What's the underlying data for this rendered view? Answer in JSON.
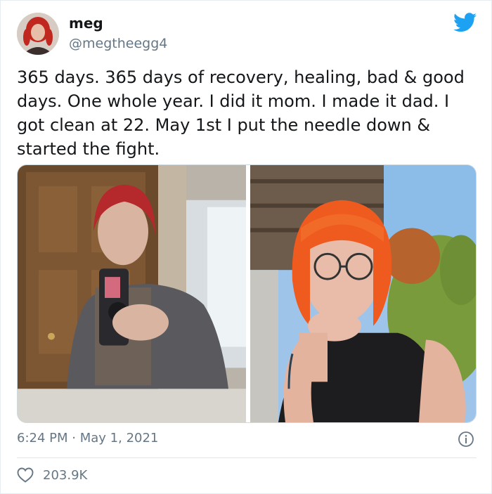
{
  "tweet": {
    "author_name": "meg",
    "author_handle": "@megtheegg4",
    "text": "365 days. 365 days of recovery, healing, bad & good days. One whole year. I did it mom. I made it dad. I got clean at 22. May 1st I put the needle down & started the fight.",
    "time": "6:24 PM",
    "separator": "·",
    "date": "May 1, 2021",
    "likes": "203.9K"
  },
  "icons": {
    "platform": "twitter-bird-icon",
    "info": "info-icon",
    "like": "heart-icon"
  },
  "colors": {
    "brand_blue": "#1da1f2",
    "secondary_text": "#657786",
    "primary_text": "#14171a"
  }
}
